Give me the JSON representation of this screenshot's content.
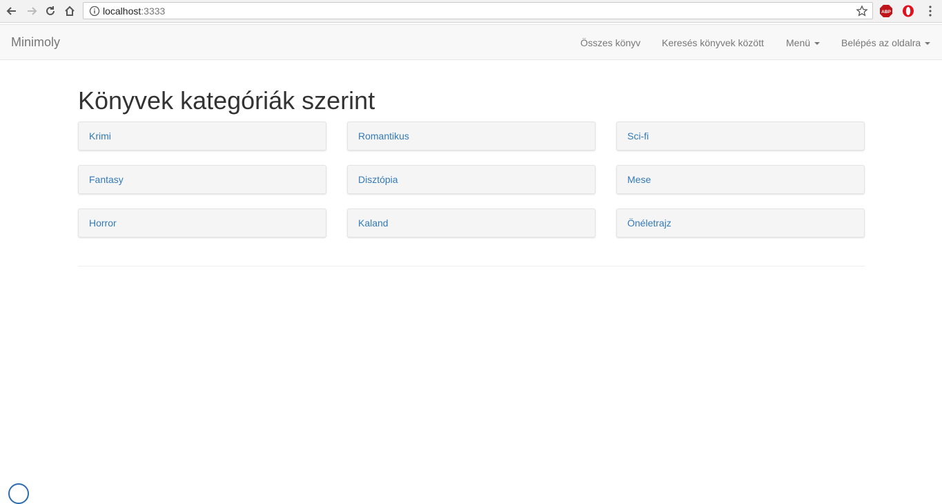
{
  "browser": {
    "url_host": "localhost",
    "url_port": ":3333",
    "ext_abp_label": "ABP"
  },
  "navbar": {
    "brand": "Minimoly",
    "links": {
      "all_books": "Összes könyv",
      "search_books": "Keresés könyvek között",
      "menu": "Menü",
      "login": "Belépés az oldalra"
    }
  },
  "main": {
    "title": "Könyvek kategóriák szerint",
    "categories": [
      "Krimi",
      "Romantikus",
      "Sci-fi",
      "Fantasy",
      "Disztópia",
      "Mese",
      "Horror",
      "Kaland",
      "Önéletrajz"
    ]
  },
  "colors": {
    "link": "#337ab7",
    "navbar_bg": "#f8f8f8",
    "navbar_text": "#777777",
    "title_text": "#333333"
  }
}
